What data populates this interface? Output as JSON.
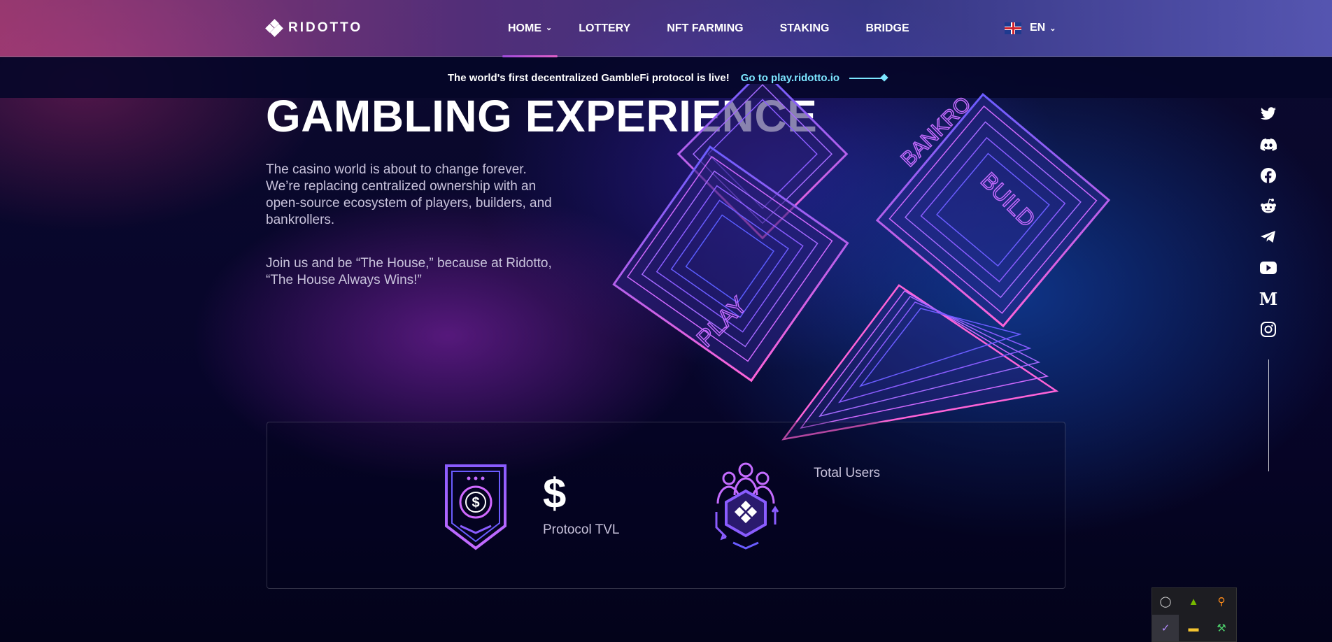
{
  "brand": {
    "name": "RIDOTTO"
  },
  "nav": {
    "items": [
      {
        "label": "HOME",
        "active": true,
        "has_dropdown": true
      },
      {
        "label": "LOTTERY"
      },
      {
        "label": "NFT FARMING"
      },
      {
        "label": "STAKING"
      },
      {
        "label": "BRIDGE"
      }
    ],
    "language": "EN"
  },
  "announcement": {
    "text": "The world's first decentralized GambleFi protocol is live!",
    "link_label": "Go to play.ridotto.io"
  },
  "hero": {
    "title": "GAMBLING EXPERIENCE",
    "paragraph1": "The casino world is about to change forever. We’re replacing centralized ownership with an open-source ecosystem of players, builders, and bankrollers.",
    "paragraph2": "Join us and be “The House,” because at Ridotto, “The House Always Wins!”",
    "art_labels": {
      "play": "PLAY",
      "build": "BUILD",
      "bankroll": "BANKRO"
    }
  },
  "stats": {
    "tvl_value": "$",
    "tvl_label": "Protocol TVL",
    "users_label": "Total Users"
  },
  "social": [
    "twitter-icon",
    "discord-icon",
    "facebook-icon",
    "reddit-icon",
    "telegram-icon",
    "youtube-icon",
    "medium-icon",
    "instagram-icon"
  ],
  "colors": {
    "accent_pink": "#e060c8",
    "accent_purple": "#8a4ddc",
    "link_cyan": "#7ce6ff"
  }
}
